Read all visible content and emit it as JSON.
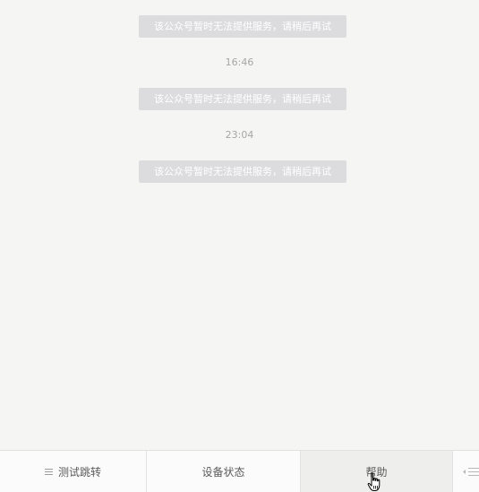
{
  "chat": {
    "messages": [
      {
        "type": "system",
        "text": "该公众号暂时无法提供服务，请稍后再试"
      },
      {
        "type": "time",
        "text": "16:46"
      },
      {
        "type": "system",
        "text": "该公众号暂时无法提供服务，请稍后再试"
      },
      {
        "type": "time",
        "text": "23:04"
      },
      {
        "type": "system",
        "text": "该公众号暂时无法提供服务，请稍后再试"
      }
    ]
  },
  "menu_bar": {
    "items": [
      {
        "label": "测试跳转",
        "icon": "hamburger-icon"
      },
      {
        "label": "设备状态"
      },
      {
        "label": "帮助"
      },
      {
        "icon": "keyboard-switch-icon"
      }
    ]
  },
  "colors": {
    "chat_background": "#f5f5f4",
    "system_message_bg": "#dcdcdf",
    "timestamp_text": "#a6a6a6",
    "menu_active_bg": "#eeeeec"
  }
}
